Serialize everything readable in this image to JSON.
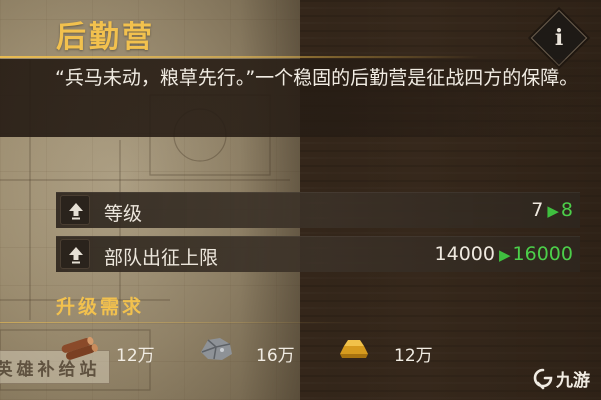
{
  "panel": {
    "title": "后勤营",
    "info_glyph": "i",
    "description": "“兵马未动，粮草先行。”一个稳固的后勤营是征战四方的保障。"
  },
  "stats": [
    {
      "icon": "upgrade-arrow-icon",
      "label": "等级",
      "current": "7",
      "next": "8"
    },
    {
      "icon": "upgrade-arrow-icon",
      "label": "部队出征上限",
      "current": "14000",
      "next": "16000"
    }
  ],
  "arrow_glyph": "▶",
  "requirements": {
    "title": "升级需求",
    "resources": [
      {
        "icon": "wood-icon",
        "amount": "12万"
      },
      {
        "icon": "iron-ore-icon",
        "amount": "16万"
      },
      {
        "icon": "gold-ingot-icon",
        "amount": "12万"
      }
    ]
  },
  "background": {
    "stamp_text": "英雄补给站"
  },
  "watermark": {
    "text": "九游"
  },
  "colors": {
    "title_gold": "#f2c14e",
    "upgrade_green": "#4ccf4a",
    "text_light": "#f1ece3"
  }
}
